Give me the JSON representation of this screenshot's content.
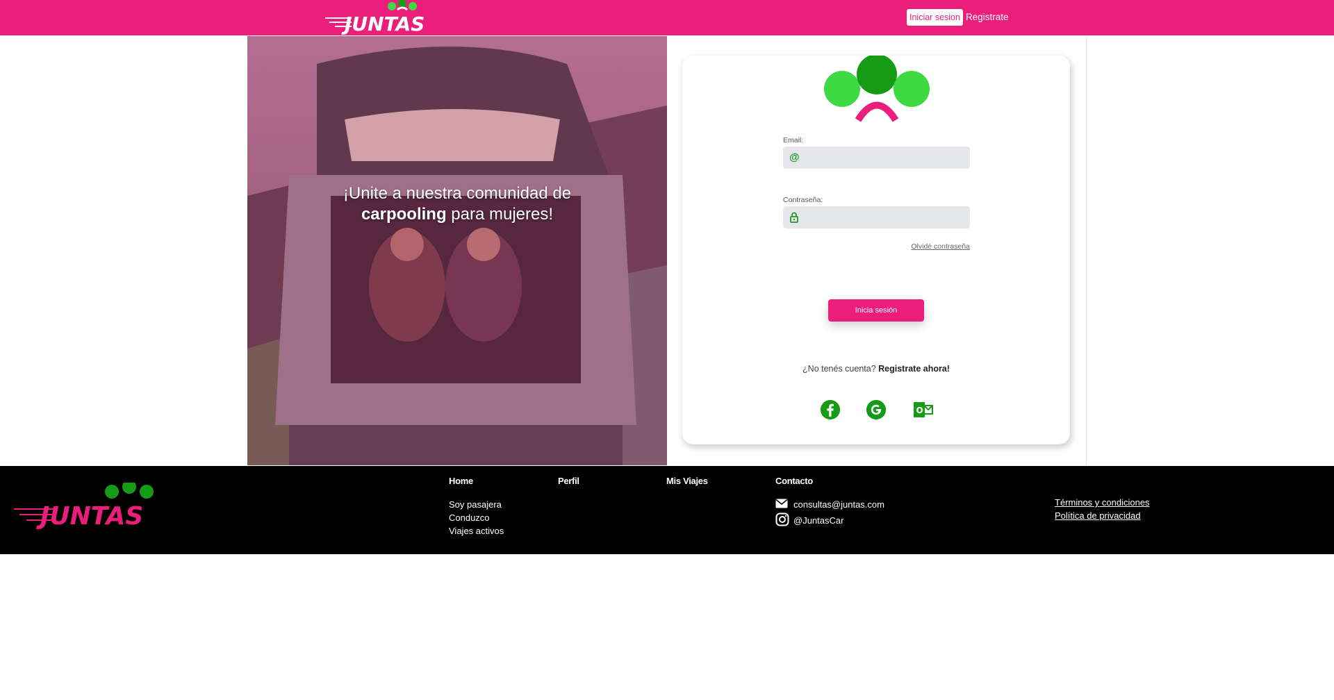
{
  "header": {
    "logo_text": "JUNTAS",
    "nav_login": "Iniciar sesion",
    "nav_register": "Registrate"
  },
  "hero": {
    "line1": "¡Unite a nuestra comunidad de",
    "line2_bold": "carpooling",
    "line2_rest": " para mujeres!"
  },
  "login": {
    "email_label": "Email:",
    "email_value": "",
    "password_label": "Contraseña:",
    "password_value": "",
    "forgot": "Olvidé contraseña",
    "submit": "Inicia sesión",
    "no_account": "¿No tenés cuenta? ",
    "register_now": "Registrate ahora!",
    "social": [
      "facebook-icon",
      "google-icon",
      "outlook-icon"
    ]
  },
  "footer": {
    "logo_text": "JUNTAS",
    "columns": [
      {
        "title": "Home",
        "links": [
          "Soy pasajera",
          "Conduzco",
          "Viajes activos"
        ]
      },
      {
        "title": "Perfil",
        "links": []
      },
      {
        "title": "Mis Viajes",
        "links": []
      },
      {
        "title": "Contacto",
        "links": []
      }
    ],
    "contact": {
      "email": "consultas@juntas.com",
      "instagram": "@JuntasCar"
    },
    "legal": [
      "Términos y condiciones",
      "Política de privacidad"
    ]
  },
  "colors": {
    "brand_pink": "#ec1e7c",
    "brand_green": "#169b16",
    "light_green": "#3fd944"
  }
}
